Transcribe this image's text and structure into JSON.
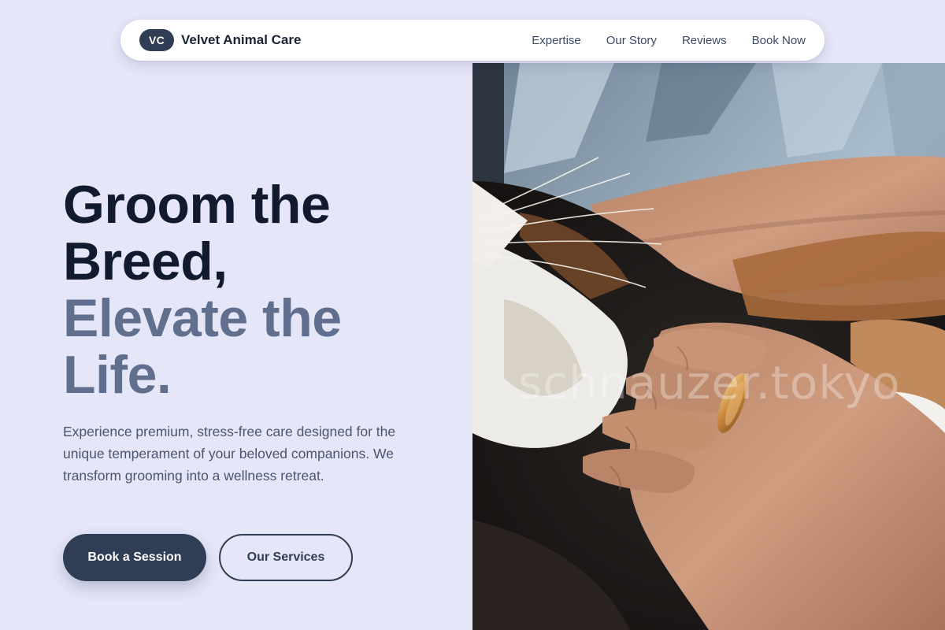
{
  "brand": {
    "badge": "VC",
    "name": "Velvet Animal Care"
  },
  "nav": {
    "items": [
      {
        "label": "Expertise"
      },
      {
        "label": "Our Story"
      },
      {
        "label": "Reviews"
      },
      {
        "label": "Book Now"
      }
    ]
  },
  "hero": {
    "title_line1": "Groom the",
    "title_line2": "Breed,",
    "title_line3": "Elevate the",
    "title_line4": "Life.",
    "description": "Experience premium, stress-free care designed for the unique temperament of your beloved companions. We transform grooming into a wellness retreat.",
    "primary_button": "Book a Session",
    "secondary_button": "Our Services",
    "image_watermark": "schnauzer.tokyo"
  },
  "colors": {
    "background": "#e6e6f9",
    "primary": "#2f3d55",
    "title_dark": "#111a2e",
    "title_muted": "#5f6f8d"
  }
}
